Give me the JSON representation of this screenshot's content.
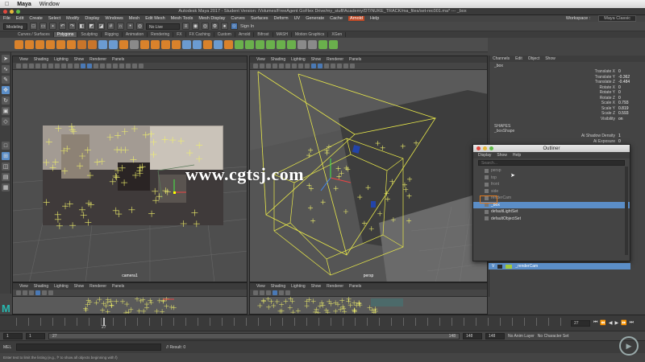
{
  "mac_menu": {
    "app": "Maya",
    "window": "Window"
  },
  "title": "Autodesk Maya 2017 - Student Version: /Volumes/FreeAgent GoFlex Drive/my_stuff/Academy/DT/NUKE_TRACK/ma_files/set-rec001.ma* --- _box",
  "menus": [
    "File",
    "Edit",
    "Create",
    "Select",
    "Modify",
    "Display",
    "Windows",
    "Mesh",
    "Edit Mesh",
    "Mesh Tools",
    "Mesh Display",
    "Curves",
    "Surfaces",
    "Deform",
    "UV",
    "Generate",
    "Cache",
    "Arnold",
    "Help"
  ],
  "menu_highlight": "Arnold",
  "workspace": {
    "label": "Workspace :",
    "value": "Maya Classic"
  },
  "status": {
    "mode": "Modeling",
    "live_surface": "No Live Surface",
    "sign_in": "Sign In"
  },
  "shelf_tabs": [
    "Curves / Surfaces",
    "Polygons",
    "Sculpting",
    "Rigging",
    "Animation",
    "Rendering",
    "FX",
    "FX Caching",
    "Custom",
    "Arnold",
    "Bifrost",
    "MASH",
    "Motion Graphics",
    "XGen"
  ],
  "shelf_active": "Polygons",
  "panel_menu": [
    "View",
    "Shading",
    "Lighting",
    "Show",
    "Renderer",
    "Panels"
  ],
  "viewport_left_label": "camera1",
  "viewport_right_label": "persp",
  "channel_menu": [
    "Channels",
    "Edit",
    "Object",
    "Show"
  ],
  "object_name": "_box",
  "attributes": [
    {
      "k": "Translate X",
      "v": "0"
    },
    {
      "k": "Translate Y",
      "v": "-0.362"
    },
    {
      "k": "Translate Z",
      "v": "-0.484"
    },
    {
      "k": "Rotate X",
      "v": "0"
    },
    {
      "k": "Rotate Y",
      "v": "0"
    },
    {
      "k": "Rotate Z",
      "v": "0"
    },
    {
      "k": "Scale X",
      "v": "0.793"
    },
    {
      "k": "Scale Y",
      "v": "0.819"
    },
    {
      "k": "Scale Z",
      "v": "0.593"
    },
    {
      "k": "Visibility",
      "v": "on"
    }
  ],
  "shapes": {
    "header": "SHAPES",
    "name": "_boxShape",
    "attrs": [
      {
        "k": "Ai Shadow Density",
        "v": "1"
      },
      {
        "k": "Ai Exposure",
        "v": "0"
      }
    ]
  },
  "outliner": {
    "title": "Outliner",
    "menu": [
      "Display",
      "Show",
      "Help"
    ],
    "search_placeholder": "Search...",
    "items": [
      {
        "label": "persp",
        "style": "dim"
      },
      {
        "label": "top",
        "style": "dim"
      },
      {
        "label": "front",
        "style": "dim"
      },
      {
        "label": "side",
        "style": "dim"
      },
      {
        "label": "renderCam",
        "style": "dim"
      },
      {
        "label": "_box",
        "style": "sel"
      },
      {
        "label": "defaultLightSet",
        "style": "w"
      },
      {
        "label": "defaultObjectSet",
        "style": "w"
      }
    ]
  },
  "layer": {
    "vis": "V",
    "name": "_renderCam"
  },
  "timeline": {
    "current": "27",
    "end_field": "27"
  },
  "range": {
    "start": "1",
    "start2": "1",
    "mid": "27",
    "end": "148",
    "end2": "148",
    "end3": "148",
    "anim_layer": "No Anim Layer",
    "char_set": "No Character Set"
  },
  "cmd": {
    "lang": "MEL",
    "result": "// Result: 0"
  },
  "helpline": "Enter text to limit the listing (e.g., f* to show all objects beginning with f)",
  "watermark": "www.cgtsj.com",
  "colors": {
    "accent_select": "#5b8ec8",
    "highlight_orange": "#d98a2b",
    "menu_highlight": "#c04a26",
    "wire_yellow": "#e8e84a"
  }
}
